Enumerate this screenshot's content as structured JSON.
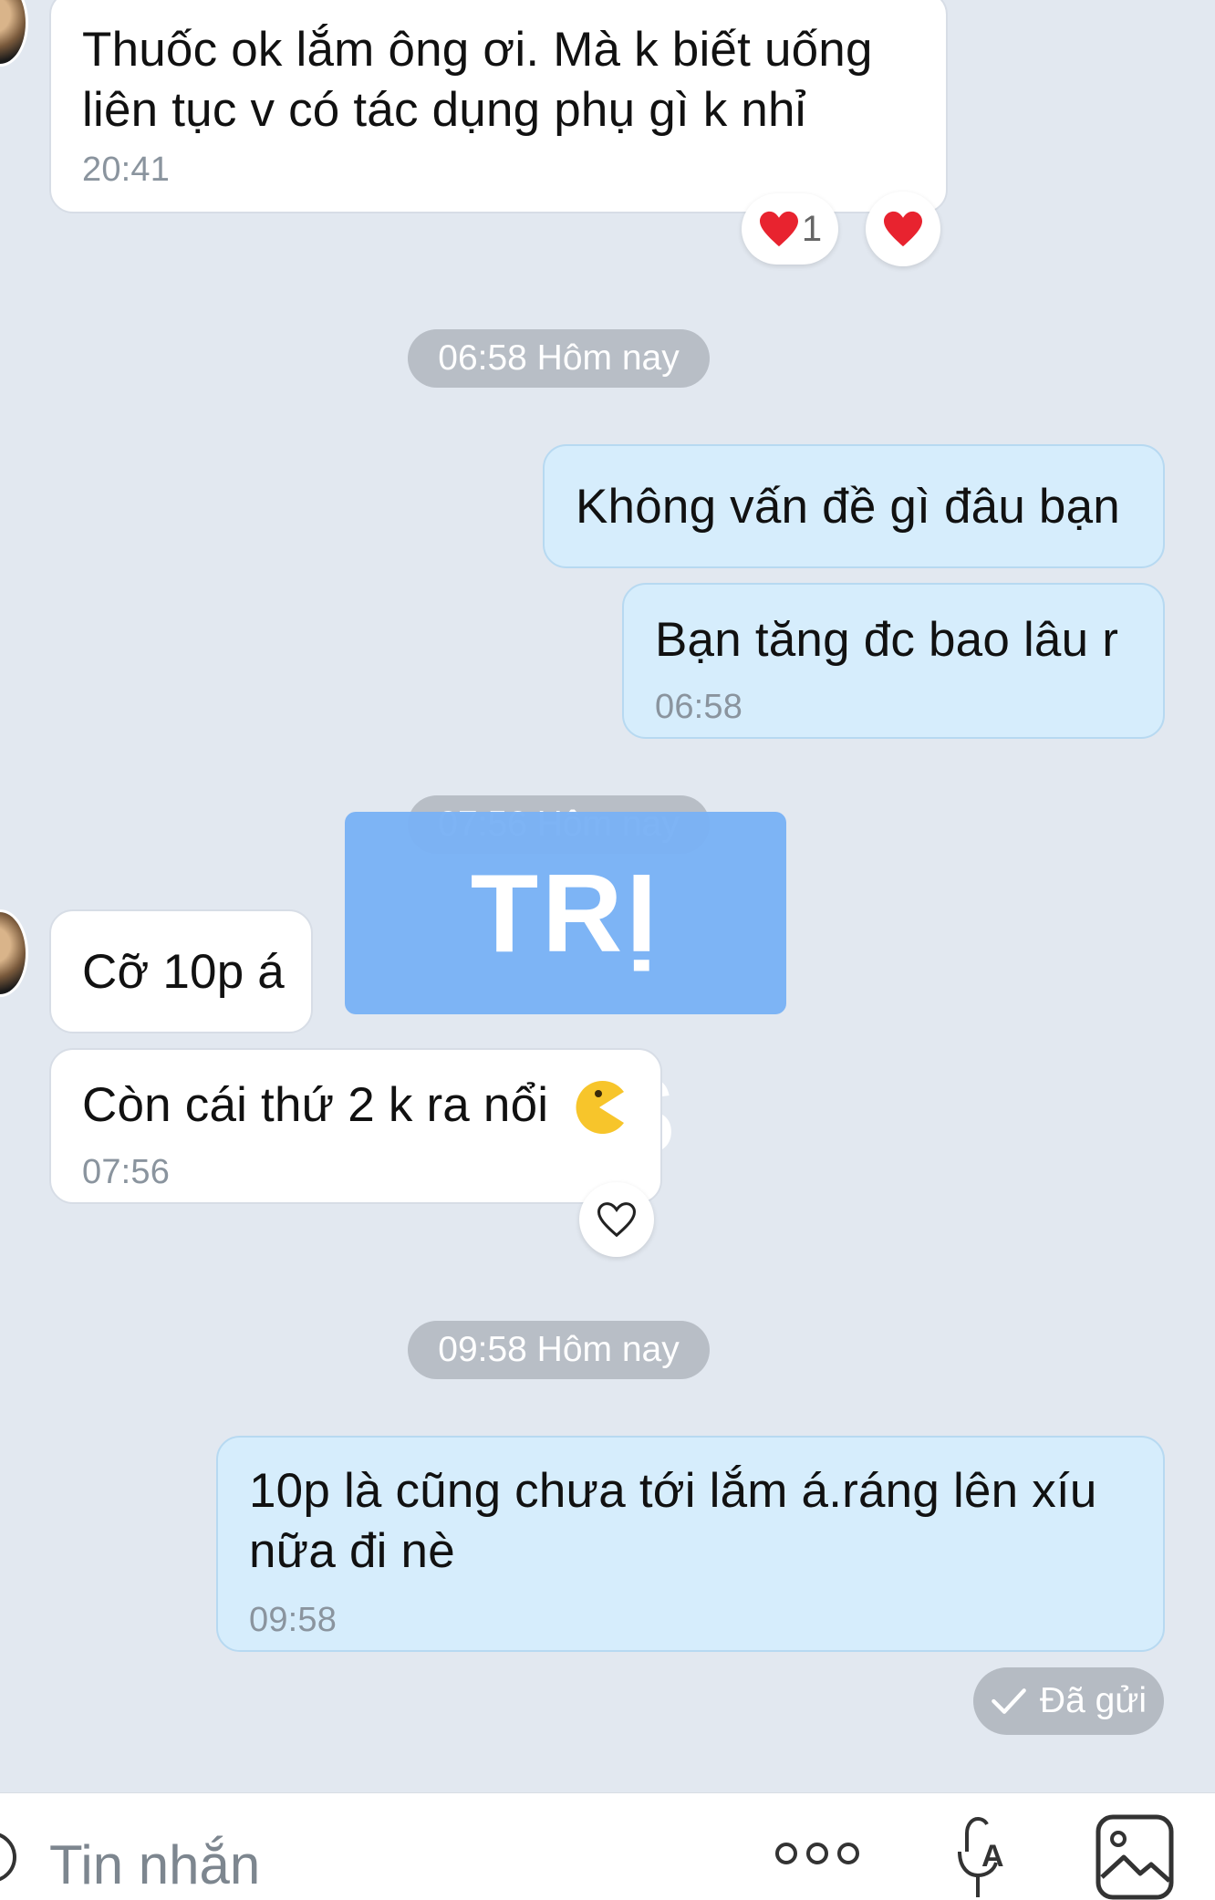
{
  "messages": [
    {
      "text_line1": "Thuốc ok lắm ông ơi. Mà k biết uống",
      "text_line2": "liên tục v có tác dụng phụ gì k nhỉ",
      "time": "20:41"
    },
    {
      "text": "Không vấn đề gì đâu bạn"
    },
    {
      "text": "Bạn tăng đc bao lâu r",
      "time": "06:58"
    },
    {
      "text": "Cỡ 10p á"
    },
    {
      "text": "Còn cái thứ 2 k ra nổi",
      "time": "07:56"
    },
    {
      "text_line1": "10p là cũng chưa tới lắm á.ráng lên xíu",
      "text_line2": "nữa đi nè",
      "time": "09:58"
    }
  ],
  "reactions": {
    "heart_count": "1"
  },
  "dividers": [
    "06:58 Hôm nay",
    "07:56 Hôm nay",
    "09:58 Hôm nay"
  ],
  "watermark": "TRỊ XTS",
  "status": {
    "label": "Đã gửi"
  },
  "composer": {
    "placeholder": "Tin nhắn"
  },
  "icons": [
    "heart-icon",
    "pacman-emoji-icon",
    "check-icon",
    "more-icon",
    "voice-text-icon",
    "image-icon"
  ],
  "colors": {
    "background": "#e2e8f0",
    "sent_bubble": "#d6edfc",
    "received_bubble": "#ffffff",
    "heart": "#e8232f",
    "watermark": "#7ab2f5"
  }
}
